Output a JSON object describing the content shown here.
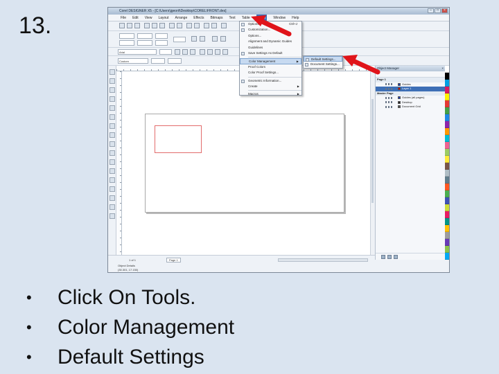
{
  "slide": {
    "number": "13.",
    "bullets": [
      "Click On Tools.",
      "Color Management",
      "Default Settings"
    ]
  },
  "app": {
    "title": "Corel DESIGNER X5 - [C:\\Users\\jgeorit\\Desktop\\COREL\\FRONT.des]",
    "menubar": [
      "File",
      "Edit",
      "View",
      "Layout",
      "Arrange",
      "Effects",
      "Bitmaps",
      "Text",
      "Table",
      "Tools",
      "Window",
      "Help"
    ],
    "active_menu": "Tools",
    "font_name": "Arial",
    "style_value": "Custom"
  },
  "tools_menu": {
    "items": [
      {
        "label": "Options...",
        "shortcut": "Ctrl+J",
        "submenu": false
      },
      {
        "label": "Customization...",
        "shortcut": "",
        "submenu": false
      },
      {
        "label": "Options...",
        "shortcut": "",
        "submenu": false
      },
      {
        "label": "Alignment and Dynamic Guides",
        "shortcut": "",
        "submenu": false
      },
      {
        "label": "Guidelines",
        "shortcut": "",
        "submenu": false
      },
      {
        "label": "Save Settings As Default",
        "shortcut": "",
        "submenu": false
      },
      {
        "label": "Color Management",
        "shortcut": "",
        "submenu": true,
        "highlighted": true
      },
      {
        "label": "Proof Colors",
        "shortcut": "",
        "submenu": false
      },
      {
        "label": "Color Proof Settings...",
        "shortcut": "",
        "submenu": false
      },
      {
        "label": "Geometric Information...",
        "shortcut": "",
        "submenu": false
      },
      {
        "label": "Create",
        "shortcut": "",
        "submenu": true
      },
      {
        "label": "Macros",
        "shortcut": "",
        "submenu": true
      }
    ]
  },
  "color_submenu": {
    "items": [
      {
        "label": "Default Settings...",
        "highlighted": true
      },
      {
        "label": "Document Settings..."
      }
    ]
  },
  "object_manager": {
    "title": "Object Manager",
    "header_page": "Page 1",
    "header_layer": "Layer 1",
    "rows": [
      {
        "label": "Page 1",
        "type": "hdr"
      },
      {
        "label": "Guides",
        "swatch": "#1a3fbf"
      },
      {
        "label": "Layer 1",
        "swatch": "#cc0000",
        "selected": true
      },
      {
        "label": "Master Page",
        "type": "hdr"
      },
      {
        "label": "Guides (all pages)",
        "swatch": "#1a3fbf"
      },
      {
        "label": "Desktop",
        "swatch": "#222222"
      },
      {
        "label": "Document Grid",
        "swatch": "#555555"
      }
    ]
  },
  "status": {
    "page_nav": "1 of 1",
    "page_tab": "Page 1",
    "object_details": "Object Details",
    "coords": "(30.301, 17.150)"
  },
  "palette_colors": [
    "#ffffff",
    "#000000",
    "#00a0e3",
    "#d81b60",
    "#fff200",
    "#e53935",
    "#43a047",
    "#1e88e5",
    "#8e24aa",
    "#ff9800",
    "#00bcd4",
    "#f06292",
    "#9ccc65",
    "#ffeb3b",
    "#795548",
    "#b0bec5",
    "#607d8b",
    "#ff5722",
    "#4caf50",
    "#3f51b5",
    "#cddc39",
    "#e91e63",
    "#009688",
    "#ffc107",
    "#9e9e9e",
    "#673ab7",
    "#8bc34a",
    "#03a9f4"
  ]
}
